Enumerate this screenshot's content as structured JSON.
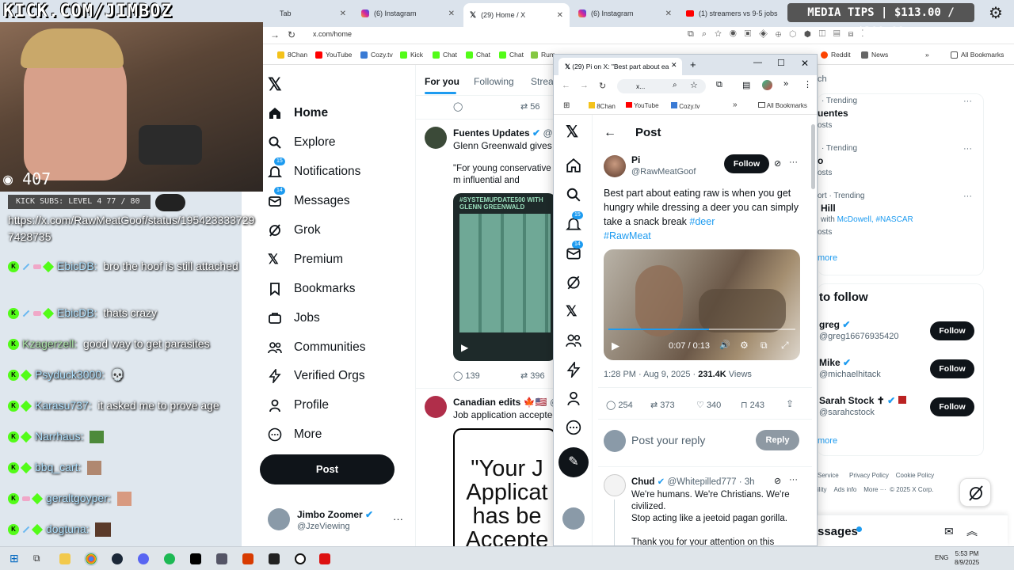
{
  "stream": {
    "logo": "KICK.COM/JIMBOZ",
    "viewers": "407",
    "subs": "KICK SUBS: LEVEL 4 77 / 80",
    "media_tips": "MEDIA TIPS | $113.00 / $200.00"
  },
  "chat": {
    "link_text": "https://x.com/RawMeatGoof/status/1954233337297428735",
    "messages": [
      {
        "user": "EbicDB:",
        "text": "bro the hoof is still attached"
      },
      {
        "user": "EbicDB:",
        "text": "thats crazy"
      },
      {
        "user": "Kzagerzell:",
        "text": "good way to get parasites"
      },
      {
        "user": "Psyduck3000:",
        "text": ""
      },
      {
        "user": "Karasu737:",
        "text": "it asked me to prove age"
      },
      {
        "user": "Narrhaus:",
        "text": ""
      },
      {
        "user": "bbq_cart:",
        "text": ""
      },
      {
        "user": "geraltgoyper:",
        "text": ""
      },
      {
        "user": "dogtuna:",
        "text": ""
      }
    ]
  },
  "browser": {
    "tabs": [
      {
        "label": "Tab"
      },
      {
        "label": "(6) Instagram"
      },
      {
        "label": "(29) Home / X"
      },
      {
        "label": "(6) Instagram"
      },
      {
        "label": "(1) streamers vs 9-5 jobs"
      }
    ],
    "url": "x.com/home",
    "bookmarks": [
      "8Chan",
      "YouTube",
      "Cozy.tv",
      "Kick",
      "Chat",
      "Chat",
      "Chat",
      "Rum",
      "Reddit",
      "News",
      "All Bookmarks"
    ]
  },
  "x_nav": {
    "items": [
      {
        "label": "Home"
      },
      {
        "label": "Explore"
      },
      {
        "label": "Notifications",
        "badge": "15"
      },
      {
        "label": "Messages",
        "badge": "14"
      },
      {
        "label": "Grok"
      },
      {
        "label": "Premium"
      },
      {
        "label": "Bookmarks"
      },
      {
        "label": "Jobs"
      },
      {
        "label": "Communities"
      },
      {
        "label": "Verified Orgs"
      },
      {
        "label": "Profile"
      },
      {
        "label": "More"
      }
    ],
    "post_button": "Post",
    "account_name": "Jimbo Zoomer",
    "account_handle": "@JzeViewing"
  },
  "feed": {
    "tabs": [
      "For you",
      "Following",
      "Strea"
    ],
    "top_reply_count": "",
    "top_repost_count": "56",
    "post1": {
      "name": "Fuentes Updates",
      "handle": "@Fu",
      "text": "Glenn Greenwald gives p",
      "quote": "\"For young conservative m influential and admired co",
      "media_label": "#SYSTEMUPDATE500 WITH GLENN GREENWALD",
      "replies": "139",
      "reposts": "396"
    },
    "post2": {
      "name": "Canadian edits",
      "handle": "@c",
      "text": "Job application accepted",
      "image_text": "\"Your J Applicat has be Accepte"
    }
  },
  "right_sidebar": {
    "search": "ch",
    "trends": [
      {
        "meta": "· Trending",
        "title": "uentes",
        "posts": "osts"
      },
      {
        "meta": "· Trending",
        "title": "o",
        "posts": "osts"
      },
      {
        "meta": "ort · Trending",
        "title": "Hill",
        "posts": "osts",
        "with": "with",
        "links": "McDowell, #NASCAR"
      }
    ],
    "show_more": "more",
    "who_to_follow": "to follow",
    "follow": [
      {
        "name": "greg",
        "handle": "@greg16676935420",
        "button": "Follow"
      },
      {
        "name": "Mike",
        "handle": "@michaelhitack",
        "button": "Follow"
      },
      {
        "name": "Sarah Stock",
        "handle": "@sarahcstock",
        "button": "Follow"
      }
    ],
    "follow_more": "more",
    "footer": [
      "Service",
      "Privacy Policy",
      "Cookie Policy",
      "ility",
      "Ads info",
      "More ···",
      "© 2025 X Corp."
    ],
    "messages": "ssages"
  },
  "popup": {
    "tab_title": "(29) Pi on X: \"Best part about ea",
    "url": "x...",
    "bookmarks": [
      "8Chan",
      "YouTube",
      "Cozy.tv",
      "All Bookmarks"
    ],
    "header": "Post",
    "author_name": "Pi",
    "author_handle": "@RawMeatGoof",
    "follow_label": "Follow",
    "text_plain": "Best part about eating raw is when you get hungry while dressing a deer you can simply take a snack break ",
    "tag1": "#deer",
    "tag2": "#RawMeat",
    "video_time": "0:07 / 0:13",
    "meta_time": "1:28 PM · Aug 9, 2025 · ",
    "views_count": "231.4K",
    "views_label": " Views",
    "stats": {
      "replies": "254",
      "reposts": "373",
      "likes": "340",
      "bookmarks": "243"
    },
    "reply_placeholder": "Post your reply",
    "reply_button": "Reply",
    "reply": {
      "name": "Chud",
      "handle": "@Whitepilled777 · 3h",
      "line1": "We're humans. We're Christians. We're civilized.",
      "line2": "Stop acting like a jeetoid pagan gorilla.",
      "line3": "Thank you for your attention on this"
    },
    "notif_badge": "15",
    "msg_badge": "14"
  },
  "taskbar": {
    "lang": "ENG",
    "time": "5:53 PM",
    "date": "8/9/2025"
  }
}
